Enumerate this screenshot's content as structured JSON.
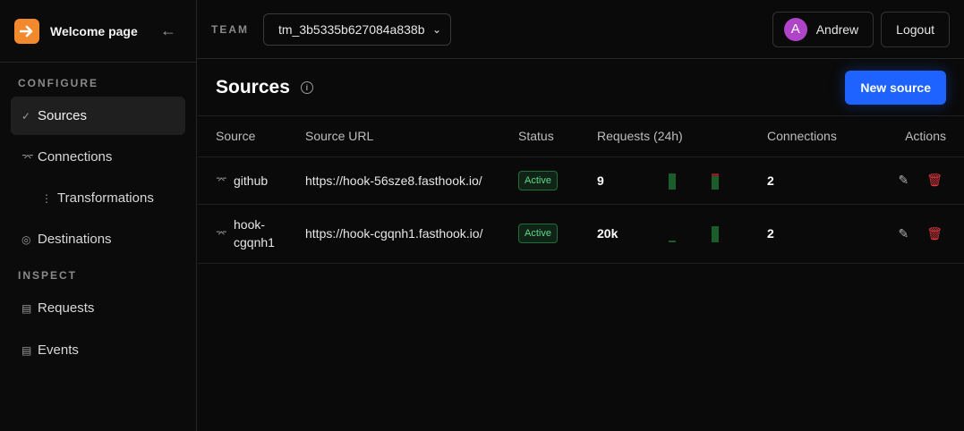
{
  "brand": {
    "title": "Welcome page",
    "collapse_icon": "arrow-left-icon"
  },
  "sidebar": {
    "configure_label": "CONFIGURE",
    "inspect_label": "INSPECT",
    "items": [
      {
        "label": "Sources",
        "icon": "check-icon"
      },
      {
        "label": "Connections",
        "icon": "link-icon"
      },
      {
        "label": "Transformations",
        "icon": "more-vertical-icon"
      },
      {
        "label": "Destinations",
        "icon": "target-icon"
      },
      {
        "label": "Requests",
        "icon": "list-icon"
      },
      {
        "label": "Events",
        "icon": "list-icon"
      }
    ]
  },
  "topbar": {
    "team_label": "TEAM",
    "team_value": "tm_3b5335b627084a838b",
    "user_initial": "A",
    "user_name": "Andrew",
    "logout_label": "Logout"
  },
  "page": {
    "title": "Sources",
    "new_button": "New source"
  },
  "table": {
    "headers": {
      "source": "Source",
      "url": "Source URL",
      "status": "Status",
      "requests": "Requests (24h)",
      "connections": "Connections",
      "actions": "Actions"
    },
    "rows": [
      {
        "source": "github",
        "url": "https://hook-56sze8.fasthook.io/",
        "status": "Active",
        "requests": "9",
        "connections": "2",
        "spark": [
          {
            "ok": 1.0,
            "err": 0.0
          },
          {
            "ok": 0.85,
            "err": 0.15
          }
        ]
      },
      {
        "source_line1": "hook-",
        "source_line2": "cgqnh1",
        "url": "https://hook-cgqnh1.fasthook.io/",
        "status": "Active",
        "requests": "20k",
        "connections": "2",
        "spark": [
          {
            "ok": 0.1,
            "err": 0.0
          },
          {
            "ok": 1.0,
            "err": 0.0
          }
        ]
      }
    ]
  },
  "colors": {
    "accent": "#1e63ff",
    "logo": "#f2892d",
    "avatar": "#b044c8",
    "spark_ok": "#1a5d2b",
    "spark_err": "#8a1e1e",
    "delete": "#e0393e"
  }
}
